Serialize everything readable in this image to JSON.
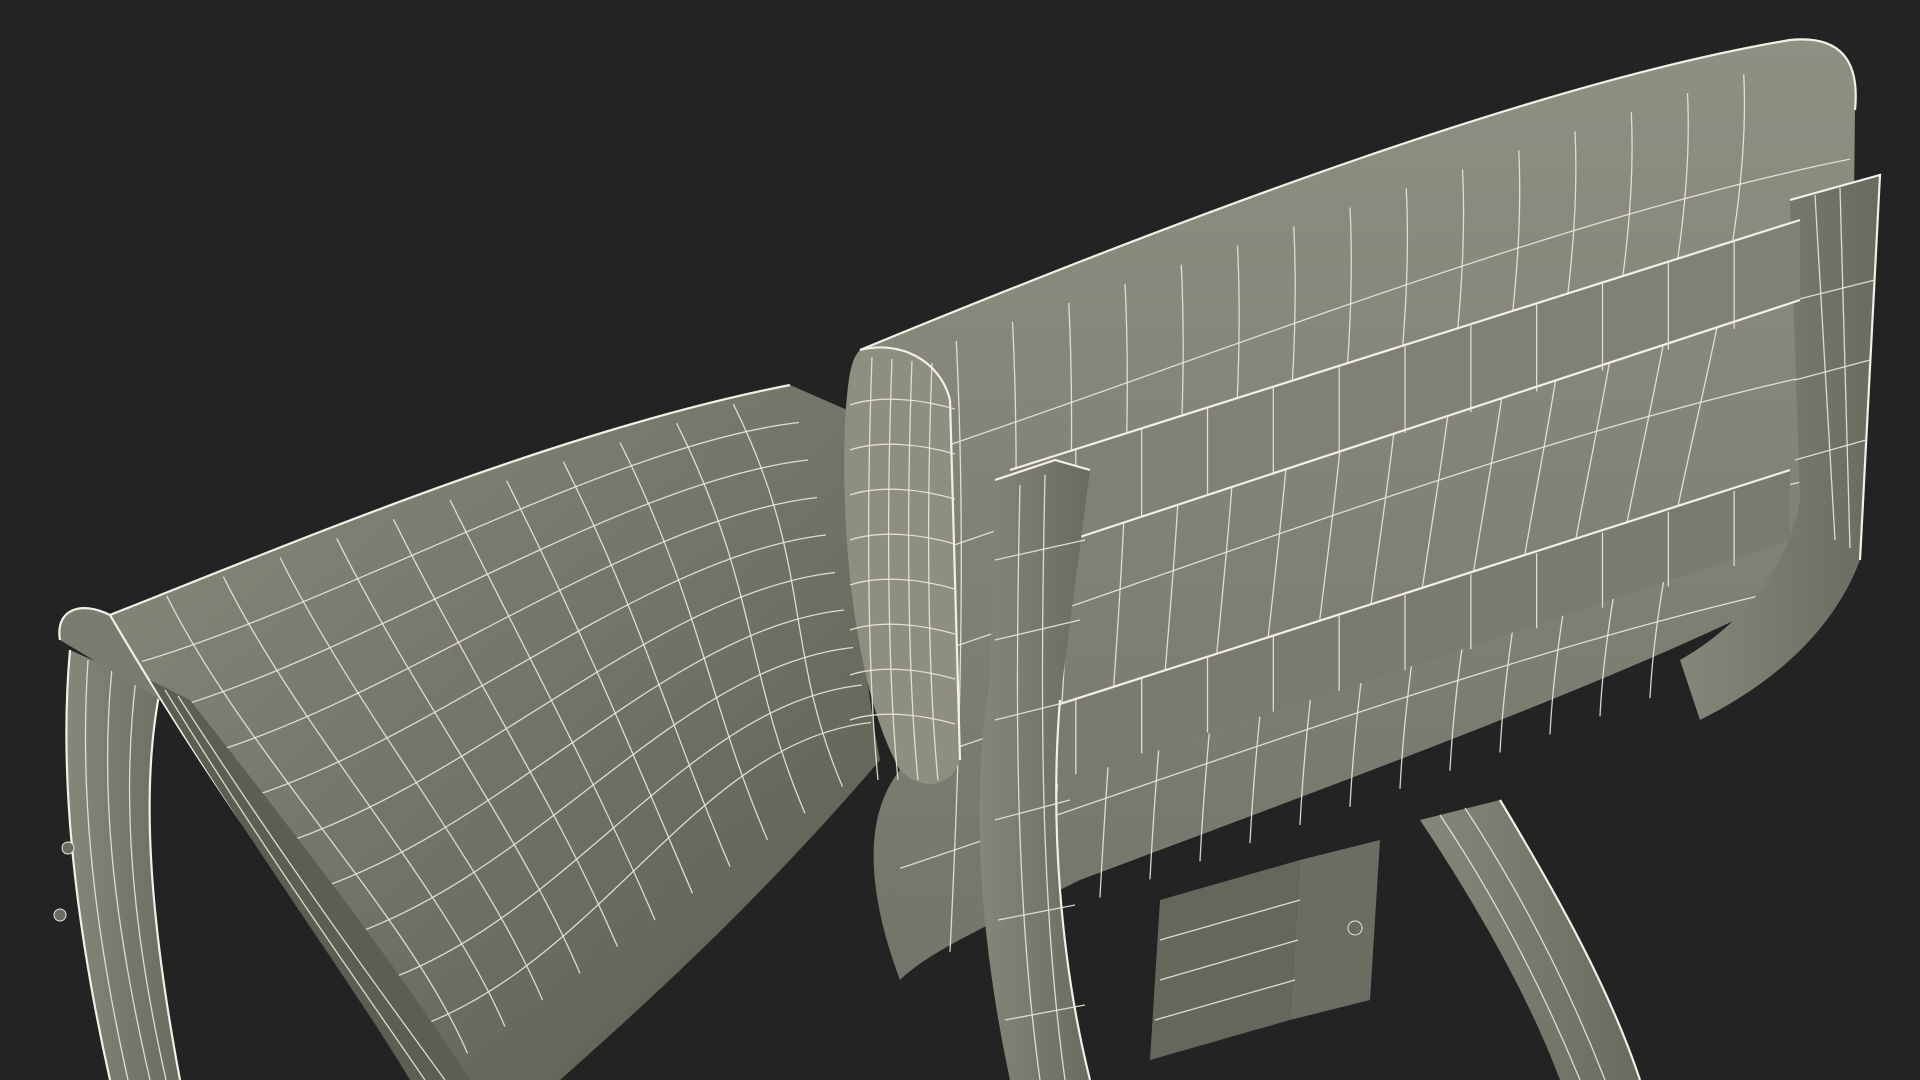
{
  "scene": {
    "subject": "armchair-wireframe-render",
    "colors": {
      "background": "#232323",
      "surface": "#7d7d70",
      "surface_light": "#8b8b7e",
      "surface_dark": "#5f5f55",
      "wire": "#eae8dc"
    }
  }
}
